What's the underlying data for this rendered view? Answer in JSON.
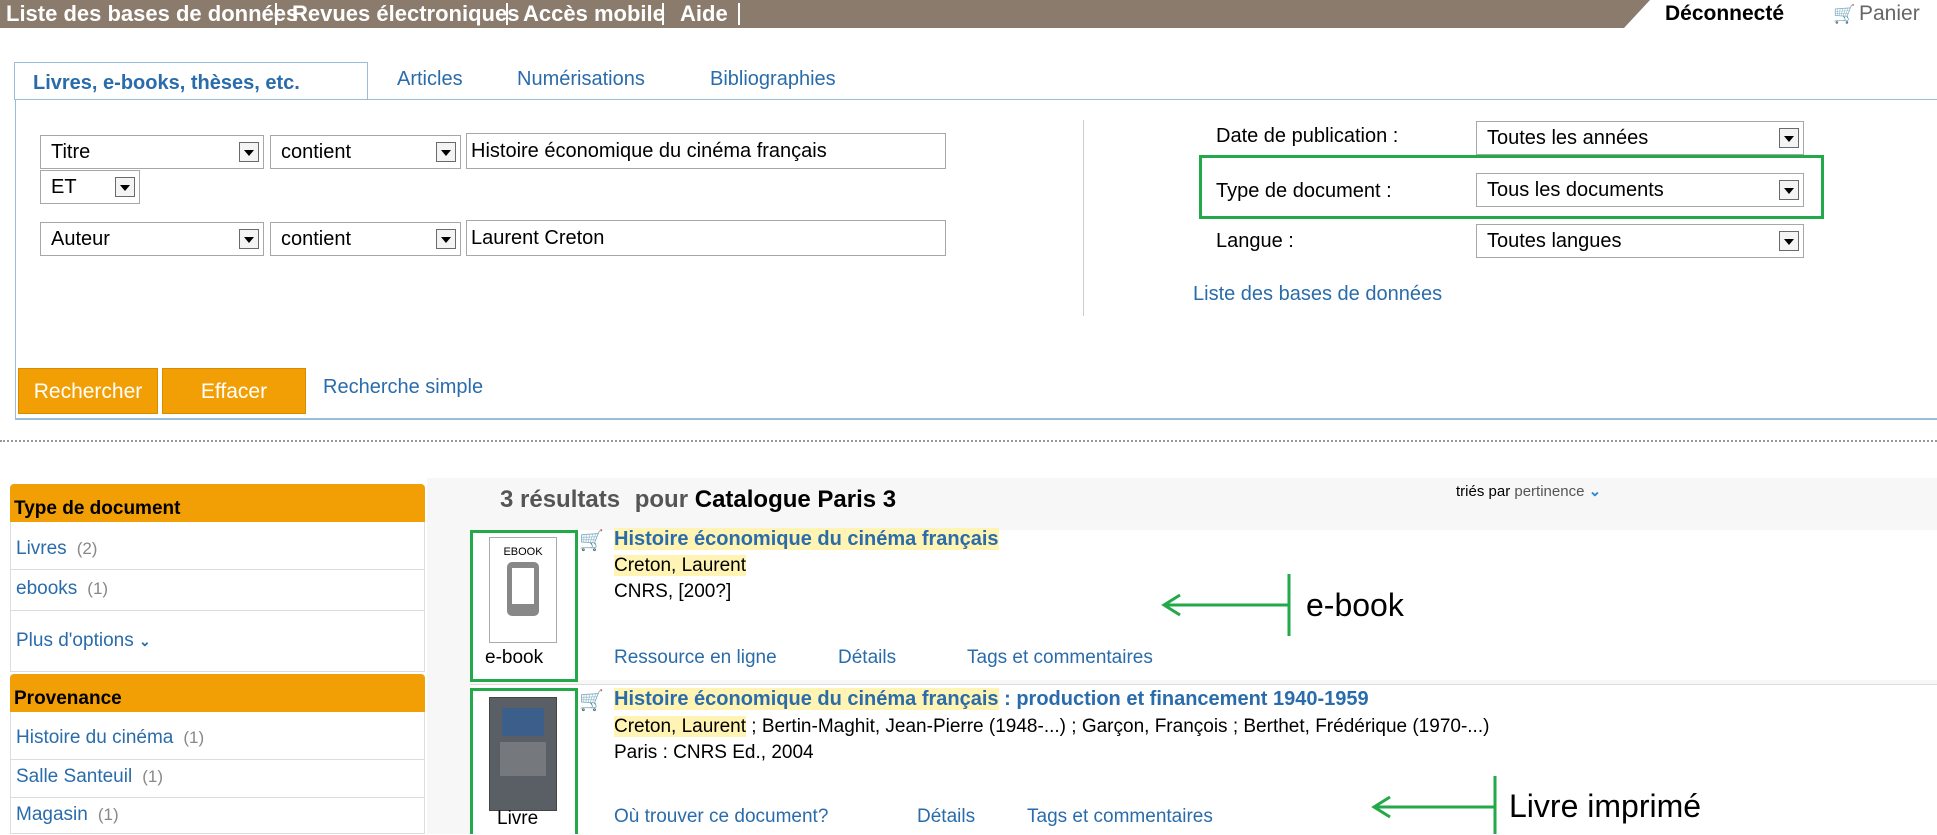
{
  "topbar": {
    "nav": [
      "Liste des bases de données",
      "Revues électroniques",
      "Accès mobile",
      "Aide"
    ],
    "status": "Déconnecté",
    "cart": "Panier"
  },
  "tabs": {
    "active": "Livres, e-books, thèses, etc.",
    "others": [
      "Articles",
      "Numérisations",
      "Bibliographies"
    ]
  },
  "search": {
    "row1": {
      "field": "Titre",
      "operator": "contient",
      "value": "Histoire économique du cinéma français"
    },
    "boolean": "ET",
    "row2": {
      "field": "Auteur",
      "operator": "contient",
      "value": "Laurent Creton"
    },
    "filters": [
      {
        "label": "Date de publication :",
        "value": "Toutes les années"
      },
      {
        "label": "Type de document :",
        "value": "Tous les documents"
      },
      {
        "label": "Langue :",
        "value": "Toutes langues"
      }
    ],
    "db_link": "Liste des bases de données",
    "buttons": {
      "search": "Rechercher",
      "clear": "Effacer"
    },
    "simple_link": "Recherche simple"
  },
  "facets": {
    "doc_type": {
      "title": "Type de document",
      "items": [
        {
          "label": "Livres",
          "count": "(2)"
        },
        {
          "label": "ebooks",
          "count": "(1)"
        }
      ],
      "more": "Plus d'options"
    },
    "provenance": {
      "title": "Provenance",
      "items": [
        {
          "label": "Histoire du cinéma",
          "count": "(1)"
        },
        {
          "label": "Salle Santeuil",
          "count": "(1)"
        },
        {
          "label": "Magasin",
          "count": "(1)"
        }
      ]
    }
  },
  "results": {
    "count": "3 résultats",
    "pour": "pour",
    "catalogue": "Catalogue Paris 3",
    "sort_label": "triés par",
    "sort_value": "pertinence",
    "items": [
      {
        "thumb_top": "EBOOK",
        "thumb_label": "e-book",
        "title_part1": "Histoire économique du cinéma français",
        "title_part2": "",
        "author_hl": "Creton, Laurent",
        "authors_rest": "",
        "publisher": "CNRS, [200?]",
        "links": [
          "Ressource en ligne",
          "Détails",
          "Tags et commentaires"
        ]
      },
      {
        "thumb_label": "Livre",
        "title_part1": "Histoire économique du cinéma français",
        "title_part2": " : production et financement 1940-1959",
        "author_hl": "Creton, Laurent",
        "authors_rest": " ; Bertin-Maghit, Jean-Pierre (1948-...) ; Garçon, François ; Berthet, Frédérique (1970-...)",
        "publisher": "Paris : CNRS Ed., 2004",
        "links": [
          "Où trouver ce document?",
          "Détails",
          "Tags et commentaires"
        ]
      }
    ]
  },
  "annotations": {
    "ebook": "e-book",
    "print": "Livre imprimé"
  },
  "colors": {
    "accent": "#f29f05",
    "link": "#2a6cab",
    "annotation_green": "#23a94a",
    "topbar": "#8a7b6c"
  }
}
